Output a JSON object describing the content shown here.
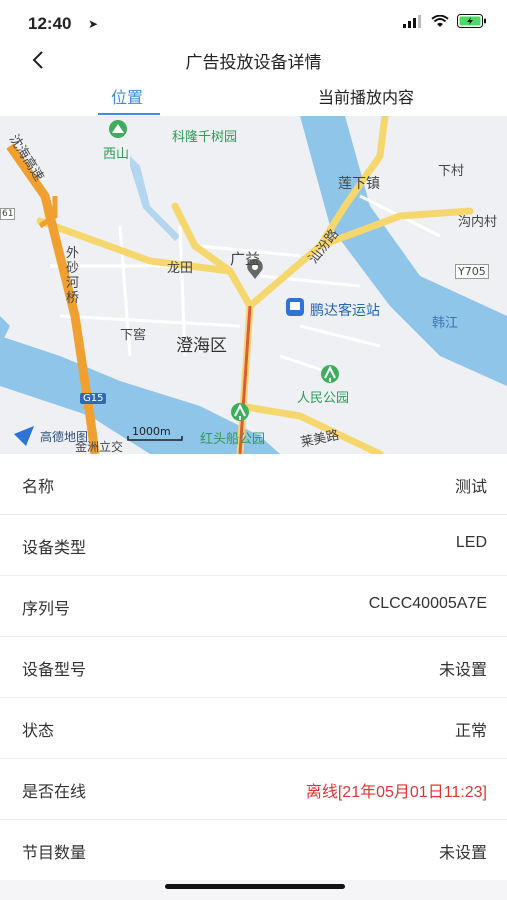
{
  "status_bar": {
    "time": "12:40"
  },
  "header": {
    "title": "广告投放设备详情"
  },
  "tabs": [
    {
      "label": "位置"
    },
    {
      "label": "当前播放内容"
    }
  ],
  "map": {
    "labels": {
      "west_mountain": "西山",
      "kelong": "科隆千树园",
      "lianxia": "莲下镇",
      "xiacun": "下村",
      "gounei": "沟内村",
      "y705": "Y705",
      "hanjiang": "韩江",
      "guangyi": "广益",
      "longtian": "龙田",
      "pengda": "鹏达客运站",
      "xiawo": "下窖",
      "chenghai": "澄海区",
      "renmin_park": "人民公园",
      "hongtou_park": "红头船公园",
      "laimei_road": "莱美路",
      "shanhe_road": "汕汾路",
      "waisha_bridge": "外砂河桥",
      "expressway": "沈海高速",
      "g15": "G15",
      "jinzhou": "金洲立交",
      "scale": "1000m",
      "logo": "高德地图",
      "road_61": "61"
    }
  },
  "details": [
    {
      "key": "名称",
      "value": "测试"
    },
    {
      "key": "设备类型",
      "value": "LED"
    },
    {
      "key": "序列号",
      "value": "CLCC40005A7E"
    },
    {
      "key": "设备型号",
      "value": "未设置"
    },
    {
      "key": "状态",
      "value": "正常"
    },
    {
      "key": "是否在线",
      "value": "离线[21年05月01日11:23]"
    },
    {
      "key": "节目数量",
      "value": "未设置"
    }
  ],
  "colors": {
    "accent": "#3a8ee6",
    "offline": "#e03535",
    "road_yellow": "#f5d76e",
    "road_orange": "#f0a030",
    "water": "#8ec5e8"
  }
}
